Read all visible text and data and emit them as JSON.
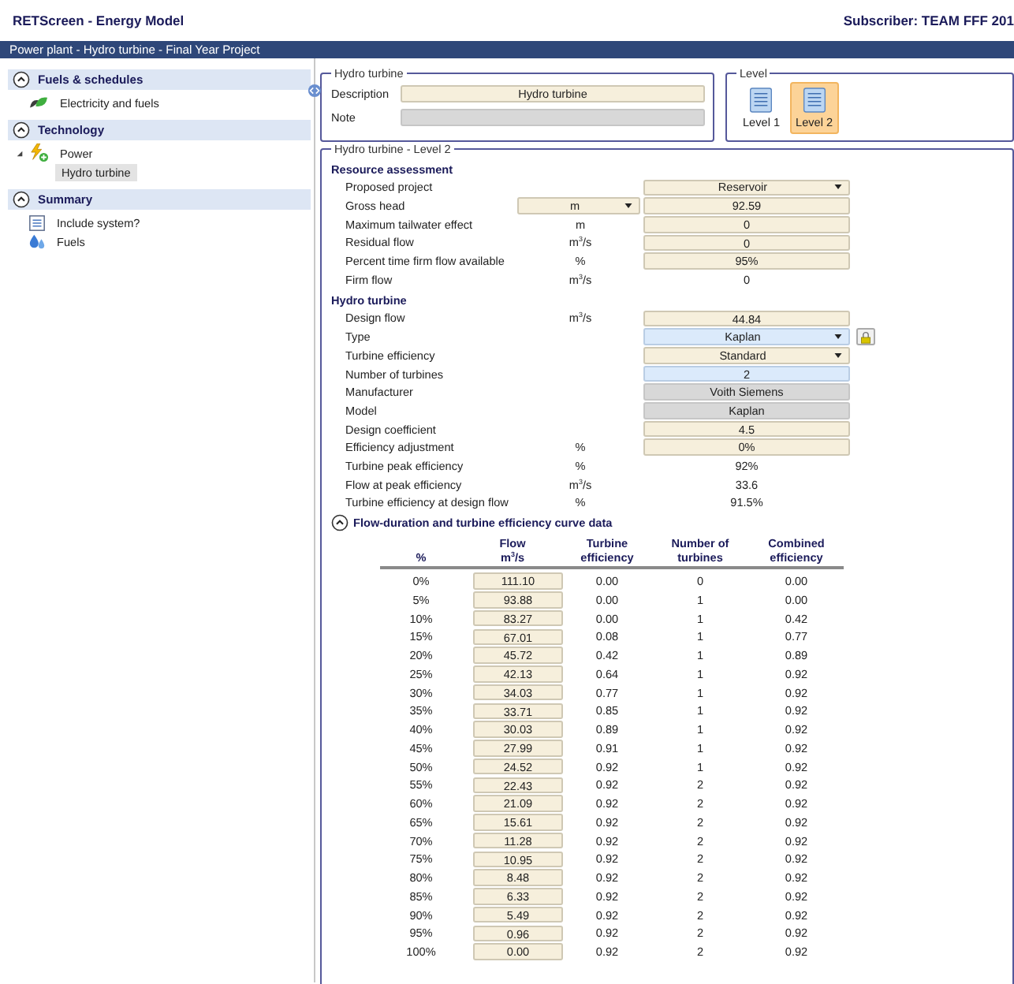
{
  "header": {
    "title": "RETScreen - Energy Model",
    "subscriber": "Subscriber: TEAM FFF 201"
  },
  "breadcrumb": "Power plant - Hydro turbine - Final Year Project",
  "sidebar": {
    "sections": [
      {
        "title": "Fuels & schedules",
        "expanded": true,
        "items": [
          {
            "label": "Electricity and fuels",
            "kind": "leaf",
            "selected": false
          }
        ]
      },
      {
        "title": "Technology",
        "expanded": true,
        "items": [
          {
            "label": "Power",
            "kind": "power",
            "selected": false,
            "expanded": true,
            "children": [
              {
                "label": "Hydro turbine",
                "selected": true
              }
            ]
          }
        ]
      },
      {
        "title": "Summary",
        "expanded": true,
        "items": [
          {
            "label": "Include system?",
            "kind": "checklist",
            "selected": false
          },
          {
            "label": "Fuels",
            "kind": "drop",
            "selected": false
          }
        ]
      }
    ]
  },
  "description_box": {
    "title": "Hydro turbine",
    "fields": [
      {
        "label": "Description",
        "value": "Hydro turbine",
        "disabled": false
      },
      {
        "label": "Note",
        "disabled": true
      }
    ]
  },
  "level_box": {
    "title": "Level",
    "options": [
      {
        "label": "Level 1",
        "selected": false
      },
      {
        "label": "Level 2",
        "selected": true
      }
    ]
  },
  "detail": {
    "title": "Hydro turbine - Level 2",
    "sections": [
      {
        "title": "Resource assessment",
        "rows": [
          {
            "label": "Proposed project",
            "kind": "dropdown",
            "value": "Reservoir",
            "highlighted": false,
            "side_button": false
          },
          {
            "label": "Gross head",
            "unit": "m",
            "unit_dropdown": true,
            "kind": "input",
            "value": "92.59",
            "highlighted": false,
            "side_button": false
          },
          {
            "label": "Maximum tailwater effect",
            "unit": "m",
            "unit_dropdown": false,
            "kind": "input",
            "value": "0",
            "highlighted": false,
            "side_button": false
          },
          {
            "label": "Residual flow",
            "unit": "m$^{3}$/s",
            "unit_dropdown": false,
            "kind": "input",
            "value": "0",
            "highlighted": false,
            "side_button": false
          },
          {
            "label": "Percent time firm flow available",
            "unit": "%",
            "unit_dropdown": false,
            "kind": "input",
            "value": "95%",
            "highlighted": false,
            "side_button": false
          },
          {
            "label": "Firm flow",
            "unit": "m$^{3}$/s",
            "unit_dropdown": false,
            "kind": "plain",
            "value": "0",
            "side_button": false
          }
        ]
      },
      {
        "title": "Hydro turbine",
        "rows": [
          {
            "label": "Design flow",
            "unit": "m$^{3}$/s",
            "unit_dropdown": false,
            "kind": "input",
            "value": "44.84",
            "highlighted": false,
            "side_button": false
          },
          {
            "label": "Type",
            "kind": "dropdown",
            "value": "Kaplan",
            "highlighted": true,
            "side_button": true
          },
          {
            "label": "Turbine efficiency",
            "kind": "dropdown",
            "value": "Standard",
            "highlighted": false,
            "side_button": false
          },
          {
            "label": "Number of turbines",
            "kind": "input",
            "value": "2",
            "highlighted": true,
            "side_button": false
          },
          {
            "label": "Manufacturer",
            "kind": "locked",
            "value": "Voith Siemens",
            "side_button": false
          },
          {
            "label": "Model",
            "kind": "locked",
            "value": "Kaplan",
            "side_button": false
          },
          {
            "label": "Design coefficient",
            "kind": "input",
            "value": "4.5",
            "highlighted": false,
            "side_button": false
          },
          {
            "label": "Efficiency adjustment",
            "unit": "%",
            "unit_dropdown": false,
            "kind": "input",
            "value": "0%",
            "highlighted": false,
            "side_button": false
          },
          {
            "label": "Turbine peak efficiency",
            "unit": "%",
            "unit_dropdown": false,
            "kind": "plain",
            "value": "92%",
            "side_button": false
          },
          {
            "label": "Flow at peak efficiency",
            "unit": "m$^{3}$/s",
            "unit_dropdown": false,
            "kind": "plain",
            "value": "33.6",
            "side_button": false
          },
          {
            "label": "Turbine efficiency at design flow",
            "unit": "%",
            "unit_dropdown": false,
            "kind": "plain",
            "value": "91.5%",
            "side_button": false
          }
        ]
      }
    ],
    "curve": {
      "title": "Flow-duration and turbine efficiency curve data",
      "expanded": true,
      "columns": [
        {
          "lines": [
            "%"
          ],
          "kind": "plain"
        },
        {
          "lines": [
            "Flow",
            "m$^{3}$/s"
          ],
          "kind": "input"
        },
        {
          "lines": [
            "Turbine",
            "efficiency"
          ],
          "kind": "plain"
        },
        {
          "lines": [
            "Number of",
            "turbines"
          ],
          "kind": "plain"
        },
        {
          "lines": [
            "Combined",
            "efficiency"
          ],
          "kind": "plain"
        }
      ],
      "rows": [
        [
          "0%",
          "111.10",
          "0.00",
          "0",
          "0.00"
        ],
        [
          "5%",
          "93.88",
          "0.00",
          "1",
          "0.00"
        ],
        [
          "10%",
          "83.27",
          "0.00",
          "1",
          "0.42"
        ],
        [
          "15%",
          "67.01",
          "0.08",
          "1",
          "0.77"
        ],
        [
          "20%",
          "45.72",
          "0.42",
          "1",
          "0.89"
        ],
        [
          "25%",
          "42.13",
          "0.64",
          "1",
          "0.92"
        ],
        [
          "30%",
          "34.03",
          "0.77",
          "1",
          "0.92"
        ],
        [
          "35%",
          "33.71",
          "0.85",
          "1",
          "0.92"
        ],
        [
          "40%",
          "30.03",
          "0.89",
          "1",
          "0.92"
        ],
        [
          "45%",
          "27.99",
          "0.91",
          "1",
          "0.92"
        ],
        [
          "50%",
          "24.52",
          "0.92",
          "1",
          "0.92"
        ],
        [
          "55%",
          "22.43",
          "0.92",
          "2",
          "0.92"
        ],
        [
          "60%",
          "21.09",
          "0.92",
          "2",
          "0.92"
        ],
        [
          "65%",
          "15.61",
          "0.92",
          "2",
          "0.92"
        ],
        [
          "70%",
          "11.28",
          "0.92",
          "2",
          "0.92"
        ],
        [
          "75%",
          "10.95",
          "0.92",
          "2",
          "0.92"
        ],
        [
          "80%",
          "8.48",
          "0.92",
          "2",
          "0.92"
        ],
        [
          "85%",
          "6.33",
          "0.92",
          "2",
          "0.92"
        ],
        [
          "90%",
          "5.49",
          "0.92",
          "2",
          "0.92"
        ],
        [
          "95%",
          "0.96",
          "0.92",
          "2",
          "0.92"
        ],
        [
          "100%",
          "0.00",
          "0.92",
          "2",
          "0.92"
        ]
      ]
    }
  }
}
